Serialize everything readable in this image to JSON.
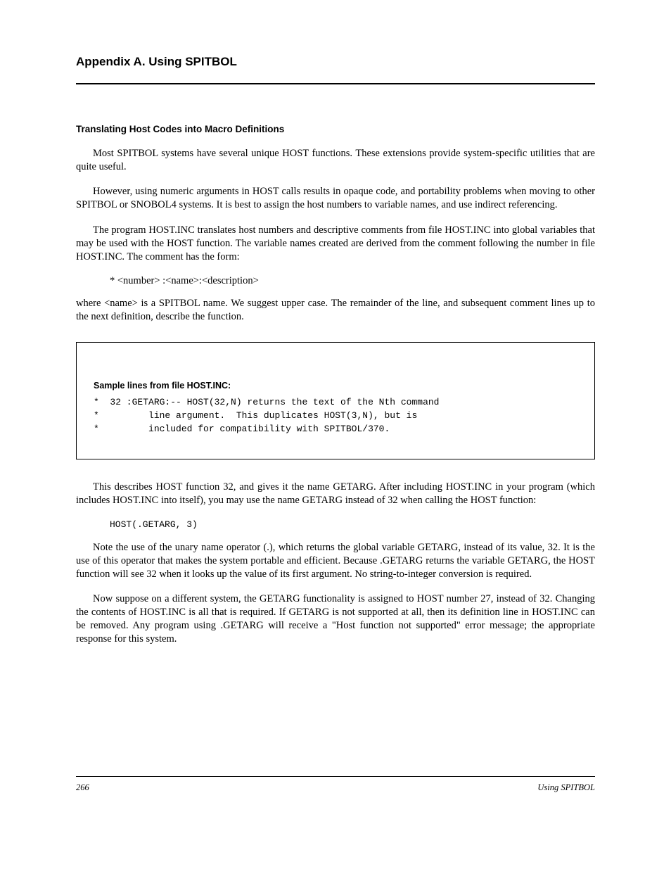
{
  "header": {
    "title": "Appendix A. Using SPITBOL"
  },
  "sections": [
    {
      "title": "Translating Host Codes into Macro Definitions",
      "paragraphs": [
        "Most SPITBOL systems have several unique HOST functions. These extensions provide system-specific utilities that are quite useful.",
        "However, using numeric arguments in HOST calls results in opaque code, and portability problems when moving to other SPITBOL or SNOBOL4 systems. It is best to assign the host numbers to variable names, and use indirect referencing.",
        "The program HOST.INC translates host numbers and descriptive comments from file HOST.INC into global variables that may be used with the HOST function. The variable names created are derived from the comment following the number in file HOST.INC. The comment has the form:"
      ]
    }
  ],
  "box": {
    "title": "Sample lines from file HOST.INC:",
    "lines": [
      "*  32 :GETARG:-- HOST(32,N) returns the text of the Nth command",
      "*         line argument.  This duplicates HOST(3,N), but is",
      "*         included for compatibility with SPITBOL/370."
    ]
  },
  "paragraphs_after": [
    "This describes HOST function 32, and gives it the name GETARG. After including HOST.INC in your program (which includes HOST.INC into itself), you may use the name GETARG instead of 32 when calling the HOST function:",
    "HOST(.GETARG, 3)"
  ],
  "note_paragraphs": [
    "Note the use of the unary name operator (.), which returns the global variable GETARG, instead of its value, 32. It is the use of this operator that makes the system portable and efficient. Because .GETARG returns the variable GETARG, the HOST function will see 32 when it looks up the value of its first argument. No string-to-integer conversion is required.",
    "Now suppose on a different system, the GETARG functionality is assigned to HOST number 27, instead of 32. Changing the contents of HOST.INC is all that is required. If GETARG is not supported at all, then its definition line in HOST.INC can be removed. Any program using .GETARG will receive a \"Host function not supported\" error message; the appropriate response for this system."
  ],
  "footer": {
    "left": "266",
    "right": "Using SPITBOL"
  }
}
